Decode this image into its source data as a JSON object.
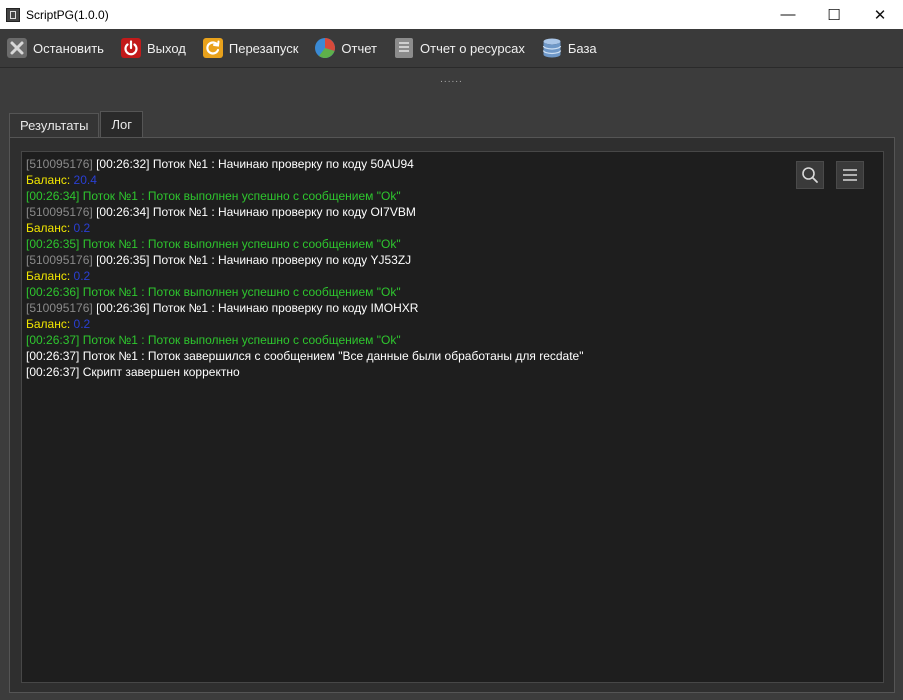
{
  "window": {
    "title": "ScriptPG(1.0.0)",
    "minimize": "—",
    "maximize": "☐",
    "close": "✕"
  },
  "toolbar": {
    "stop": "Остановить",
    "exit": "Выход",
    "restart": "Перезапуск",
    "report": "Отчет",
    "resource_report": "Отчет о ресурсах",
    "database": "База"
  },
  "splitter": "......",
  "tabs": [
    {
      "label": "Результаты",
      "active": false
    },
    {
      "label": "Лог",
      "active": true
    }
  ],
  "log": [
    {
      "id": "[510095176]",
      "time": "[00:26:32]",
      "text": "Поток №1 : Начинаю проверку по коду 50AU94"
    },
    {
      "label": "Баланс:",
      "value": "20.4"
    },
    {
      "success": "[00:26:34] Поток №1 : Поток выполнен успешно с сообщением \"Ok\""
    },
    {
      "id": "[510095176]",
      "time": "[00:26:34]",
      "text": "Поток №1 : Начинаю проверку по коду OI7VBM"
    },
    {
      "label": "Баланс:",
      "value": "0.2"
    },
    {
      "success": "[00:26:35] Поток №1 : Поток выполнен успешно с сообщением \"Ok\""
    },
    {
      "id": "[510095176]",
      "time": "[00:26:35]",
      "text": "Поток №1 : Начинаю проверку по коду YJ53ZJ"
    },
    {
      "label": "Баланс:",
      "value": "0.2"
    },
    {
      "success": "[00:26:36] Поток №1 : Поток выполнен успешно с сообщением \"Ok\""
    },
    {
      "id": "[510095176]",
      "time": "[00:26:36]",
      "text": "Поток №1 : Начинаю проверку по коду IMOHXR"
    },
    {
      "label": "Баланс:",
      "value": "0.2"
    },
    {
      "success": "[00:26:37] Поток №1 : Поток выполнен успешно с сообщением \"Ok\""
    },
    {
      "plain": "[00:26:37] Поток №1 : Поток завершился с сообщением \"Все данные были обработаны для recdate\""
    },
    {
      "plain": "[00:26:37] Скрипт завершен корректно"
    }
  ],
  "icons": {
    "stop": "close-x-icon",
    "exit": "power-icon",
    "restart": "refresh-icon",
    "report": "pie-chart-icon",
    "resource_report": "document-lines-icon",
    "database": "database-icon",
    "search": "search-icon",
    "menu": "hamburger-menu-icon"
  },
  "colors": {
    "log_id": "#8a8a8a",
    "log_text": "#ffffff",
    "balance_label": "#f2e600",
    "balance_value": "#2a3fd4",
    "success": "#2ec62e"
  }
}
